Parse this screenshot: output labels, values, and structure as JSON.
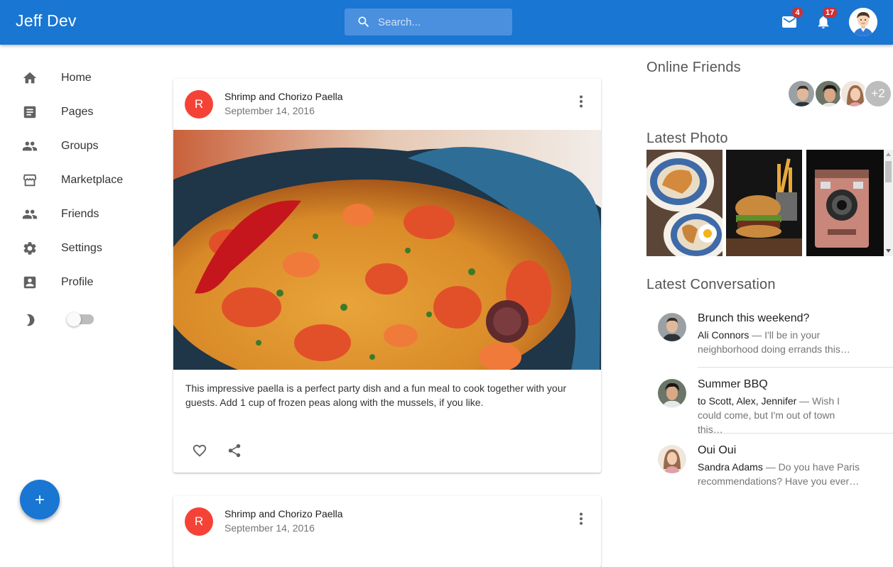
{
  "app": {
    "title": "Jeff Dev"
  },
  "search": {
    "placeholder": "Search..."
  },
  "notifications": {
    "mail_count": "4",
    "bell_count": "17"
  },
  "sidebar": {
    "items": [
      {
        "label": "Home",
        "icon": "home-icon"
      },
      {
        "label": "Pages",
        "icon": "pages-icon"
      },
      {
        "label": "Groups",
        "icon": "groups-icon"
      },
      {
        "label": "Marketplace",
        "icon": "storefront-icon"
      },
      {
        "label": "Friends",
        "icon": "friends-icon"
      },
      {
        "label": "Settings",
        "icon": "gear-icon"
      },
      {
        "label": "Profile",
        "icon": "profile-icon"
      }
    ],
    "dark_mode": false
  },
  "feed": {
    "posts": [
      {
        "avatar_letter": "R",
        "title": "Shrimp and Chorizo Paella",
        "date": "September 14, 2016",
        "text": "This impressive paella is a perfect party dish and a fun meal to cook together with your guests. Add 1 cup of frozen peas along with the mussels, if you like."
      },
      {
        "avatar_letter": "R",
        "title": "Shrimp and Chorizo Paella",
        "date": "September 14, 2016"
      }
    ]
  },
  "right": {
    "online_title": "Online Friends",
    "online_more": "+2",
    "photo_title": "Latest Photo",
    "conversation_title": "Latest Conversation",
    "conversations": [
      {
        "title": "Brunch this weekend?",
        "from": "Ali Connors",
        "snippet": " — I'll be in your neighborhood doing errands this…"
      },
      {
        "title": "Summer BBQ",
        "from": "to Scott, Alex, Jennifer",
        "snippet": " — Wish I could come, but I'm out of town this…"
      },
      {
        "title": "Oui Oui",
        "from": "Sandra Adams",
        "snippet": " — Do you have Paris recommendations? Have you ever…"
      }
    ]
  },
  "colors": {
    "primary": "#1976d2",
    "badge": "#d32f2f",
    "post_avatar": "#f44336"
  }
}
